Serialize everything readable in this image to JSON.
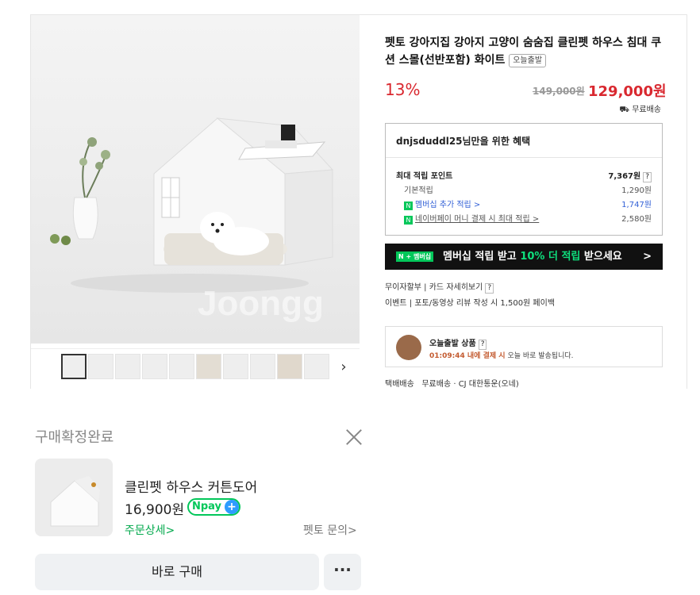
{
  "product": {
    "title": "펫토 강아지집 강아지 고양이 숨숨집 클린펫 하우스 침대 쿠션 스몰(선반포함) 화이트",
    "badge": "오늘출발",
    "discount": "13%",
    "original_price": "149,000원",
    "price": "129,000원",
    "shipping": "무료배송",
    "watermark": "Joongg"
  },
  "benefit": {
    "header": "dnjsduddl25님만을 위한 혜택",
    "max_label": "최대 적립 포인트",
    "max_value": "7,367원",
    "rows": [
      {
        "label": "기본적립",
        "value": "1,290원"
      },
      {
        "label": "멤버십 추가 적립 >",
        "value": "1,747원"
      },
      {
        "label": "네이버페이 머니 결제 시 최대 적립 >",
        "value": "2,580원"
      }
    ]
  },
  "banner": {
    "pill": "N + 멤버십",
    "text_a": "멤버십 적립 받고 ",
    "text_hl": "10% 더 적립",
    "text_b": " 받으세요",
    "arrow": ">"
  },
  "card_info": {
    "installment": "무이자할부",
    "card_benefit": "카드 자세히보기",
    "event_label": "이벤트",
    "event_text": "포토/동영상 리뷰 작성 시 1,500원 페이백"
  },
  "delivery": {
    "title": "오늘출발 상품",
    "time": "01:09:44 내에 결제 시",
    "rest": " 오늘 바로 발송됩니다.",
    "method_label": "택배배송",
    "method_text": "무료배송 · CJ 대한통운(오네)"
  },
  "order": {
    "status": "구매확정완료",
    "item_name": "클린펫 하우스 커튼도어",
    "item_price": "16,900원",
    "npay_label": "Npay",
    "npay_plus": "+",
    "order_detail": "주문상세>",
    "shop_inquiry": "펫토 문의>",
    "buy_button": "바로 구매",
    "more_button": "···"
  },
  "icons": {
    "close": "close-icon",
    "next": "chevron-right-icon",
    "truck": "truck-icon"
  }
}
